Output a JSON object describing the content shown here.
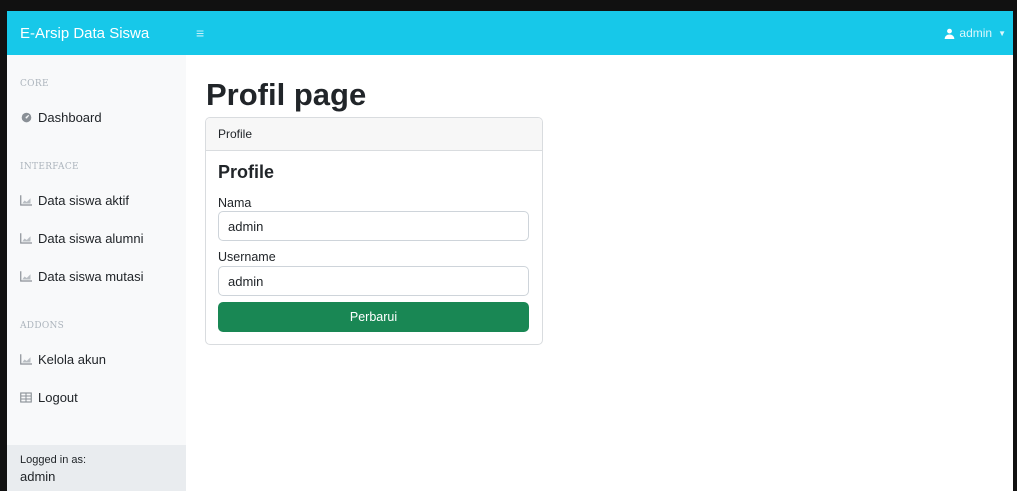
{
  "navbar": {
    "brand": "E-Arsip Data Siswa",
    "toggle_icon": "menu-icon",
    "user_label": "admin",
    "user_icon": "user-icon",
    "accent": "#17c8e9"
  },
  "sidebar": {
    "sections": [
      {
        "heading": "CORE",
        "items": [
          {
            "label": "Dashboard",
            "icon": "speedometer-icon"
          }
        ]
      },
      {
        "heading": "INTERFACE",
        "items": [
          {
            "label": "Data siswa aktif",
            "icon": "area-chart-icon"
          },
          {
            "label": "Data siswa alumni",
            "icon": "area-chart-icon"
          },
          {
            "label": "Data siswa mutasi",
            "icon": "area-chart-icon"
          }
        ]
      },
      {
        "heading": "ADDONS",
        "items": [
          {
            "label": "Kelola akun",
            "icon": "area-chart-icon"
          },
          {
            "label": "Logout",
            "icon": "table-icon"
          }
        ]
      }
    ],
    "footer": {
      "caption": "Logged in as:",
      "name": "admin"
    }
  },
  "main": {
    "title": "Profil page",
    "card": {
      "header": "Profile",
      "title": "Profile",
      "fields": [
        {
          "label": "Nama",
          "value": "admin"
        },
        {
          "label": "Username",
          "value": "admin"
        }
      ],
      "submit_label": "Perbarui",
      "submit_color": "#198754"
    }
  }
}
